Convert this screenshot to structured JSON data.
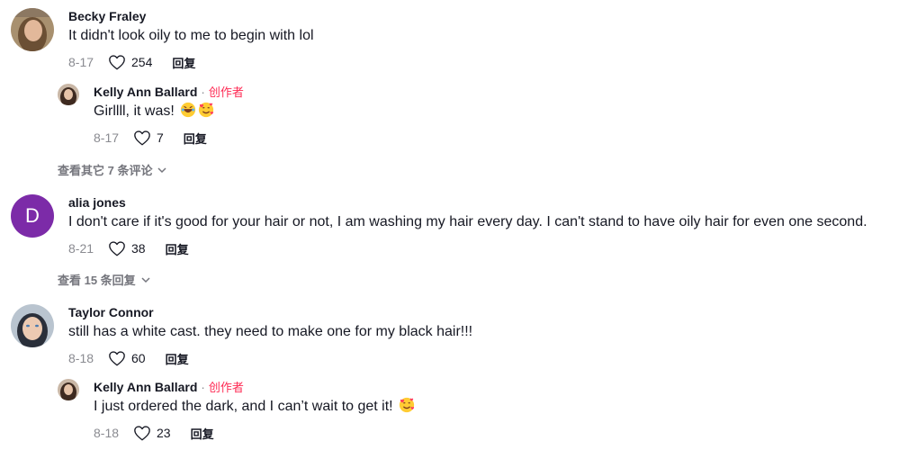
{
  "reply_label": "回复",
  "creator_sep": "·",
  "comments": [
    {
      "author": "Becky Fraley",
      "text": "It didn't look oily to me to begin with lol",
      "date": "8-17",
      "likes": "254",
      "replies": [
        {
          "author": "Kelly Ann Ballard",
          "creator_label": "创作者",
          "text": "Girllll, it was!",
          "emojis": [
            "laughing-emoji",
            "smiling-hearts-emoji"
          ],
          "date": "8-17",
          "likes": "7"
        }
      ],
      "view_more": "查看其它 7 条评论"
    },
    {
      "author": "alia jones",
      "avatar_letter": "D",
      "avatar_color": "#7c2ba8",
      "text": "I don't care if it's good for your hair or not, I am washing my hair every day. I can't stand to have oily hair for even one second.",
      "date": "8-21",
      "likes": "38",
      "view_more": "查看 15 条回复"
    },
    {
      "author": "Taylor Connor",
      "text": "still has a white cast. they need to make one for my black hair!!!",
      "date": "8-18",
      "likes": "60",
      "replies": [
        {
          "author": "Kelly Ann Ballard",
          "creator_label": "创作者",
          "text": "I just ordered the dark, and I can’t wait to get it!",
          "emojis": [
            "smiling-hearts-emoji"
          ],
          "date": "8-18",
          "likes": "23"
        }
      ]
    }
  ],
  "colors": {
    "creator": "#fe2c55",
    "muted": "#8a8b91",
    "text": "#161823"
  }
}
